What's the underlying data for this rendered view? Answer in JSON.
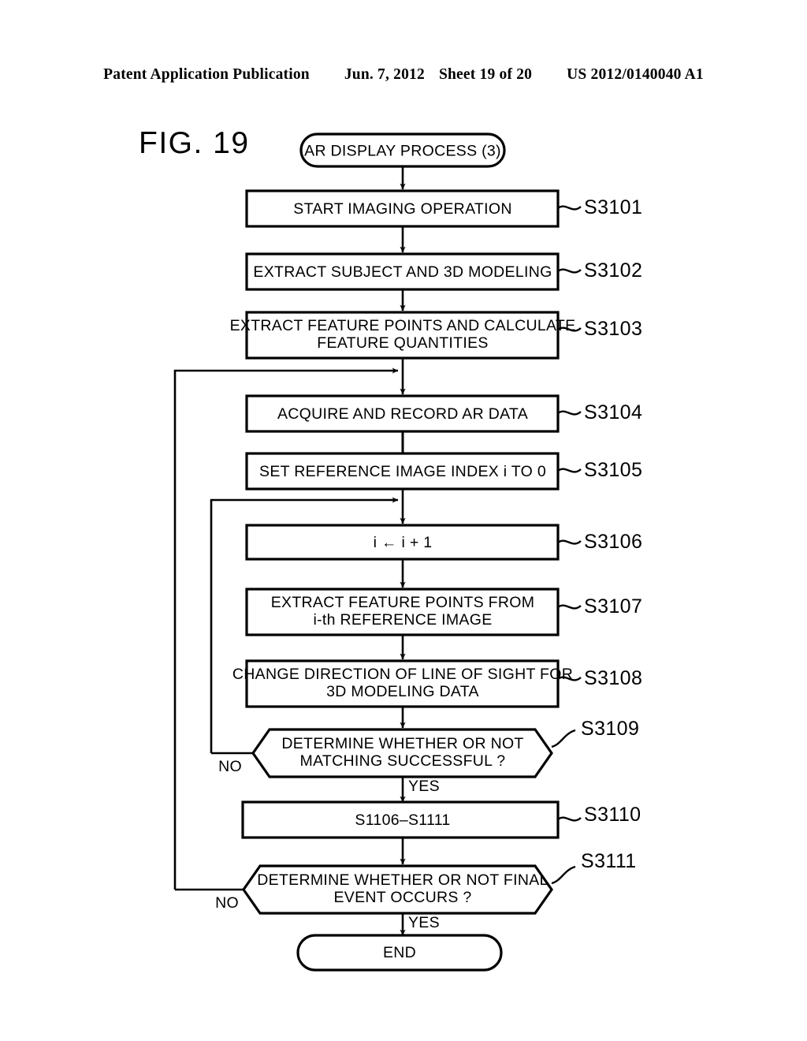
{
  "header": {
    "publication": "Patent Application Publication",
    "date": "Jun. 7, 2012",
    "sheet": "Sheet 19 of 20",
    "document_number": "US 2012/0140040 A1"
  },
  "figure": {
    "label": "FIG. 19"
  },
  "flowchart": {
    "start": {
      "text": "AR DISPLAY PROCESS (3)"
    },
    "end": {
      "text": "END"
    },
    "nodes": [
      {
        "id": "s3101",
        "type": "process",
        "step": "S3101",
        "lines": [
          "START IMAGING OPERATION"
        ]
      },
      {
        "id": "s3102",
        "type": "process",
        "step": "S3102",
        "lines": [
          "EXTRACT SUBJECT AND 3D MODELING"
        ]
      },
      {
        "id": "s3103",
        "type": "process",
        "step": "S3103",
        "lines": [
          "EXTRACT FEATURE POINTS AND CALCULATE",
          "FEATURE QUANTITIES"
        ]
      },
      {
        "id": "s3104",
        "type": "process",
        "step": "S3104",
        "lines": [
          "ACQUIRE AND RECORD AR DATA"
        ]
      },
      {
        "id": "s3105",
        "type": "process",
        "step": "S3105",
        "lines": [
          "SET REFERENCE IMAGE INDEX i TO 0"
        ]
      },
      {
        "id": "s3106",
        "type": "process",
        "step": "S3106",
        "lines": [
          "i ← i + 1"
        ]
      },
      {
        "id": "s3107",
        "type": "process",
        "step": "S3107",
        "lines": [
          "EXTRACT FEATURE POINTS FROM",
          "i-th REFERENCE IMAGE"
        ]
      },
      {
        "id": "s3108",
        "type": "process",
        "step": "S3108",
        "lines": [
          "CHANGE DIRECTION OF LINE OF SIGHT FOR",
          "3D MODELING DATA"
        ]
      },
      {
        "id": "s3109",
        "type": "decision",
        "step": "S3109",
        "lines": [
          "DETERMINE WHETHER OR NOT",
          "MATCHING SUCCESSFUL ?"
        ]
      },
      {
        "id": "s3110",
        "type": "process",
        "step": "S3110",
        "lines": [
          "S1106–S1111"
        ]
      },
      {
        "id": "s3111",
        "type": "decision",
        "step": "S3111",
        "lines": [
          "DETERMINE WHETHER OR NOT FINAL",
          "EVENT OCCURS ?"
        ]
      }
    ],
    "branch_labels": {
      "s3109_no": "NO",
      "s3109_yes": "YES",
      "s3111_no": "NO",
      "s3111_yes": "YES"
    }
  },
  "colors": {
    "ink": "#000000",
    "paper": "#ffffff"
  }
}
